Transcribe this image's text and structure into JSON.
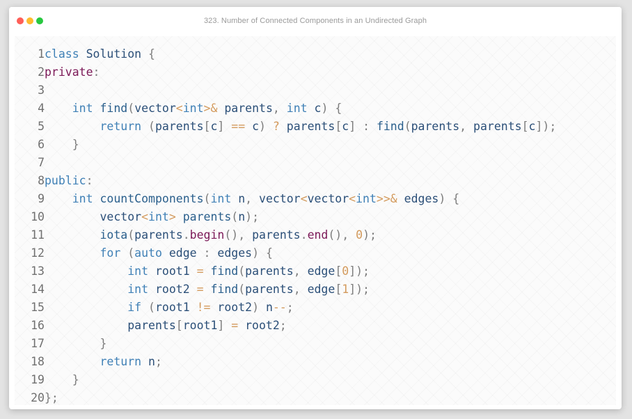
{
  "window": {
    "title": "323. Number of Connected Components in an Undirected Graph",
    "traffic_lights": [
      {
        "name": "close",
        "color": "#ff5f57"
      },
      {
        "name": "minimize",
        "color": "#febc2e"
      },
      {
        "name": "maximize",
        "color": "#28c840"
      }
    ]
  },
  "code": {
    "language": "cpp",
    "colors": {
      "keyword": "#3f80b6",
      "access_specifier": "#7b1857",
      "identifier": "#2b4f78",
      "function": "#2a5f8c",
      "operator": "#d39a5c",
      "number": "#d39a5c",
      "punctuation": "#7d7d7d",
      "line_number": "#707070"
    },
    "lines": [
      {
        "number": "1",
        "tokens": [
          [
            "kw",
            "class"
          ],
          [
            "ws",
            " "
          ],
          [
            "id",
            "Solution"
          ],
          [
            "ws",
            " "
          ],
          [
            "pun",
            "{"
          ]
        ]
      },
      {
        "number": "2",
        "tokens": [
          [
            "pri",
            "private"
          ],
          [
            "pun",
            ":"
          ]
        ]
      },
      {
        "number": "3",
        "tokens": []
      },
      {
        "number": "4",
        "tokens": [
          [
            "ws",
            "    "
          ],
          [
            "kw",
            "int"
          ],
          [
            "ws",
            " "
          ],
          [
            "fn",
            "find"
          ],
          [
            "pun",
            "("
          ],
          [
            "id",
            "vector"
          ],
          [
            "op",
            "<"
          ],
          [
            "kw",
            "int"
          ],
          [
            "op",
            ">&"
          ],
          [
            "ws",
            " "
          ],
          [
            "id",
            "parents"
          ],
          [
            "pun",
            ","
          ],
          [
            "ws",
            " "
          ],
          [
            "kw",
            "int"
          ],
          [
            "ws",
            " "
          ],
          [
            "id",
            "c"
          ],
          [
            "pun",
            ")"
          ],
          [
            "ws",
            " "
          ],
          [
            "pun",
            "{"
          ]
        ]
      },
      {
        "number": "5",
        "tokens": [
          [
            "ws",
            "        "
          ],
          [
            "kw",
            "return"
          ],
          [
            "ws",
            " "
          ],
          [
            "pun",
            "("
          ],
          [
            "id",
            "parents"
          ],
          [
            "pun",
            "["
          ],
          [
            "id",
            "c"
          ],
          [
            "pun",
            "]"
          ],
          [
            "ws",
            " "
          ],
          [
            "op",
            "=="
          ],
          [
            "ws",
            " "
          ],
          [
            "id",
            "c"
          ],
          [
            "pun",
            ")"
          ],
          [
            "ws",
            " "
          ],
          [
            "op",
            "?"
          ],
          [
            "ws",
            " "
          ],
          [
            "id",
            "parents"
          ],
          [
            "pun",
            "["
          ],
          [
            "id",
            "c"
          ],
          [
            "pun",
            "]"
          ],
          [
            "ws",
            " "
          ],
          [
            "pun",
            ":"
          ],
          [
            "ws",
            " "
          ],
          [
            "fn",
            "find"
          ],
          [
            "pun",
            "("
          ],
          [
            "id",
            "parents"
          ],
          [
            "pun",
            ","
          ],
          [
            "ws",
            " "
          ],
          [
            "id",
            "parents"
          ],
          [
            "pun",
            "["
          ],
          [
            "id",
            "c"
          ],
          [
            "pun",
            "]);"
          ]
        ]
      },
      {
        "number": "6",
        "tokens": [
          [
            "ws",
            "    "
          ],
          [
            "pun",
            "}"
          ]
        ]
      },
      {
        "number": "7",
        "tokens": []
      },
      {
        "number": "8",
        "tokens": [
          [
            "kw",
            "public"
          ],
          [
            "pun",
            ":"
          ]
        ]
      },
      {
        "number": "9",
        "tokens": [
          [
            "ws",
            "    "
          ],
          [
            "kw",
            "int"
          ],
          [
            "ws",
            " "
          ],
          [
            "fn",
            "countComponents"
          ],
          [
            "pun",
            "("
          ],
          [
            "kw",
            "int"
          ],
          [
            "ws",
            " "
          ],
          [
            "id",
            "n"
          ],
          [
            "pun",
            ","
          ],
          [
            "ws",
            " "
          ],
          [
            "id",
            "vector"
          ],
          [
            "op",
            "<"
          ],
          [
            "id",
            "vector"
          ],
          [
            "op",
            "<"
          ],
          [
            "kw",
            "int"
          ],
          [
            "op",
            ">>&"
          ],
          [
            "ws",
            " "
          ],
          [
            "id",
            "edges"
          ],
          [
            "pun",
            ")"
          ],
          [
            "ws",
            " "
          ],
          [
            "pun",
            "{"
          ]
        ]
      },
      {
        "number": "10",
        "tokens": [
          [
            "ws",
            "        "
          ],
          [
            "id",
            "vector"
          ],
          [
            "op",
            "<"
          ],
          [
            "kw",
            "int"
          ],
          [
            "op",
            ">"
          ],
          [
            "ws",
            " "
          ],
          [
            "fn",
            "parents"
          ],
          [
            "pun",
            "("
          ],
          [
            "id",
            "n"
          ],
          [
            "pun",
            ");"
          ]
        ]
      },
      {
        "number": "11",
        "tokens": [
          [
            "ws",
            "        "
          ],
          [
            "fn",
            "iota"
          ],
          [
            "pun",
            "("
          ],
          [
            "id",
            "parents"
          ],
          [
            "pun",
            "."
          ],
          [
            "pri",
            "begin"
          ],
          [
            "pun",
            "(),"
          ],
          [
            "ws",
            " "
          ],
          [
            "id",
            "parents"
          ],
          [
            "pun",
            "."
          ],
          [
            "pri",
            "end"
          ],
          [
            "pun",
            "(),"
          ],
          [
            "ws",
            " "
          ],
          [
            "num",
            "0"
          ],
          [
            "pun",
            ");"
          ]
        ]
      },
      {
        "number": "12",
        "tokens": [
          [
            "ws",
            "        "
          ],
          [
            "kw",
            "for"
          ],
          [
            "ws",
            " "
          ],
          [
            "pun",
            "("
          ],
          [
            "kw",
            "auto"
          ],
          [
            "ws",
            " "
          ],
          [
            "id",
            "edge"
          ],
          [
            "ws",
            " "
          ],
          [
            "pun",
            ":"
          ],
          [
            "ws",
            " "
          ],
          [
            "id",
            "edges"
          ],
          [
            "pun",
            ")"
          ],
          [
            "ws",
            " "
          ],
          [
            "pun",
            "{"
          ]
        ]
      },
      {
        "number": "13",
        "tokens": [
          [
            "ws",
            "            "
          ],
          [
            "kw",
            "int"
          ],
          [
            "ws",
            " "
          ],
          [
            "id",
            "root1"
          ],
          [
            "ws",
            " "
          ],
          [
            "op",
            "="
          ],
          [
            "ws",
            " "
          ],
          [
            "fn",
            "find"
          ],
          [
            "pun",
            "("
          ],
          [
            "id",
            "parents"
          ],
          [
            "pun",
            ","
          ],
          [
            "ws",
            " "
          ],
          [
            "id",
            "edge"
          ],
          [
            "pun",
            "["
          ],
          [
            "num",
            "0"
          ],
          [
            "pun",
            "]);"
          ]
        ]
      },
      {
        "number": "14",
        "tokens": [
          [
            "ws",
            "            "
          ],
          [
            "kw",
            "int"
          ],
          [
            "ws",
            " "
          ],
          [
            "id",
            "root2"
          ],
          [
            "ws",
            " "
          ],
          [
            "op",
            "="
          ],
          [
            "ws",
            " "
          ],
          [
            "fn",
            "find"
          ],
          [
            "pun",
            "("
          ],
          [
            "id",
            "parents"
          ],
          [
            "pun",
            ","
          ],
          [
            "ws",
            " "
          ],
          [
            "id",
            "edge"
          ],
          [
            "pun",
            "["
          ],
          [
            "num",
            "1"
          ],
          [
            "pun",
            "]);"
          ]
        ]
      },
      {
        "number": "15",
        "tokens": [
          [
            "ws",
            "            "
          ],
          [
            "kw",
            "if"
          ],
          [
            "ws",
            " "
          ],
          [
            "pun",
            "("
          ],
          [
            "id",
            "root1"
          ],
          [
            "ws",
            " "
          ],
          [
            "op",
            "!="
          ],
          [
            "ws",
            " "
          ],
          [
            "id",
            "root2"
          ],
          [
            "pun",
            ")"
          ],
          [
            "ws",
            " "
          ],
          [
            "id",
            "n"
          ],
          [
            "op",
            "--"
          ],
          [
            "pun",
            ";"
          ]
        ]
      },
      {
        "number": "16",
        "tokens": [
          [
            "ws",
            "            "
          ],
          [
            "id",
            "parents"
          ],
          [
            "pun",
            "["
          ],
          [
            "id",
            "root1"
          ],
          [
            "pun",
            "]"
          ],
          [
            "ws",
            " "
          ],
          [
            "op",
            "="
          ],
          [
            "ws",
            " "
          ],
          [
            "id",
            "root2"
          ],
          [
            "pun",
            ";"
          ]
        ]
      },
      {
        "number": "17",
        "tokens": [
          [
            "ws",
            "        "
          ],
          [
            "pun",
            "}"
          ]
        ]
      },
      {
        "number": "18",
        "tokens": [
          [
            "ws",
            "        "
          ],
          [
            "kw",
            "return"
          ],
          [
            "ws",
            " "
          ],
          [
            "id",
            "n"
          ],
          [
            "pun",
            ";"
          ]
        ]
      },
      {
        "number": "19",
        "tokens": [
          [
            "ws",
            "    "
          ],
          [
            "pun",
            "}"
          ]
        ]
      },
      {
        "number": "20",
        "tokens": [
          [
            "pun",
            "};"
          ]
        ]
      }
    ]
  }
}
